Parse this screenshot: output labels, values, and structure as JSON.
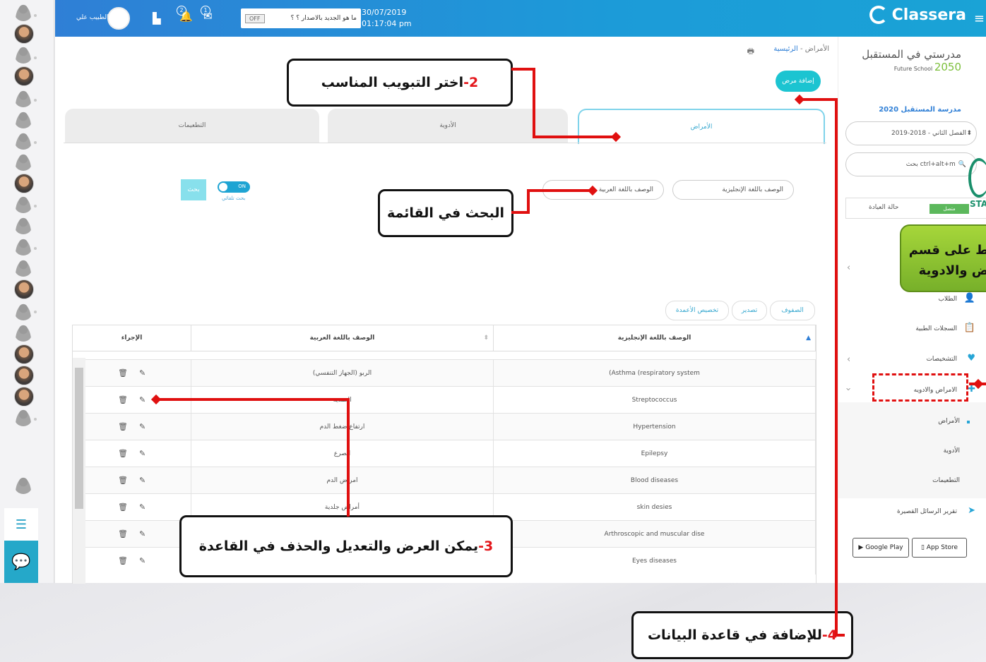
{
  "topbar": {
    "brand": "Classera",
    "date": "30/07/2019",
    "time": "01:17:04 pm",
    "whats_new": "ما هو الجديد بالاصدار ؟ ؟",
    "toggle_off": "OFF",
    "notif_count_1": "2",
    "notif_count_2": "1",
    "user_name": "الطبيب علي"
  },
  "breadcrumb": {
    "home": "الرئيسية",
    "sep": " - ",
    "current": "الأمراض"
  },
  "actions": {
    "add_patient": "إضافة مرض"
  },
  "tabs": [
    {
      "label": "الأمراض"
    },
    {
      "label": "الأدوية"
    },
    {
      "label": "التطعيمات"
    }
  ],
  "search": {
    "english_desc": "الوصف باللغة الإنجليزية",
    "arabic_desc": "الوصف باللغة العربية",
    "toggle_on": "ON",
    "auto_search": "بحث تلقائي",
    "search_button": "بحث"
  },
  "table_tools": {
    "rows": "الصفوف",
    "export": "تصدير",
    "customize": "تخصيص الأعمدة"
  },
  "table": {
    "columns": [
      "الوصف باللغة الإنجليزية",
      "الوصف باللغة العربية",
      "الإجراء"
    ],
    "rows": [
      {
        "en": "(Asthma (respiratory system",
        "ar": "الربو (الجهاز التنفسي)"
      },
      {
        "en": "Streptococcus",
        "ar": "العقدية"
      },
      {
        "en": "Hypertension",
        "ar": "ارتفاع ضغط الدم"
      },
      {
        "en": "Epilepsy",
        "ar": "الصرع"
      },
      {
        "en": "Blood diseases",
        "ar": "امراض الدم"
      },
      {
        "en": "skin desies",
        "ar": "أمراض جلدية"
      },
      {
        "en": "Arthroscopic and muscular dise",
        "ar": ""
      },
      {
        "en": "Eyes diseases",
        "ar": ""
      }
    ]
  },
  "sidebar": {
    "school_logo_text": "مدرستي في المستقبل",
    "school_logo_sub": "Future School",
    "school_logo_year": "2050",
    "school_title": "مدرسة المستقبل 2020",
    "semester": "الفصل الثاني - 2018-2019",
    "search_placeholder": "بحث ctrl+alt+m",
    "status_badge": "متصل",
    "status_label": "حالة العيادة",
    "sta": "STA",
    "students": "الطلاب",
    "medical_records": "السجلات الطبية",
    "diagnoses": "التشخيصات",
    "diseases_meds": "الامراض والادويه",
    "sub_diseases": "الأمراض",
    "sub_medicines": "الأدوية",
    "sub_vaccines": "التطعيمات",
    "sms_report": "تقرير الرسائل القصيرة",
    "google_play": "Google Play",
    "app_store": "App Store"
  },
  "annotations": {
    "c2_num": "2-",
    "c2_text": "اختر التبويب المناسب",
    "search_list": "البحث في القائمة",
    "c3_num": "3-",
    "c3_text": "يمكن العرض والتعديل والحذف في القاعدة",
    "c4_num": "4-",
    "c4_text": "للإضافة في قاعدة البيانات",
    "green_line1": "ط على قسم",
    "green_line2": "ض والادوية"
  }
}
